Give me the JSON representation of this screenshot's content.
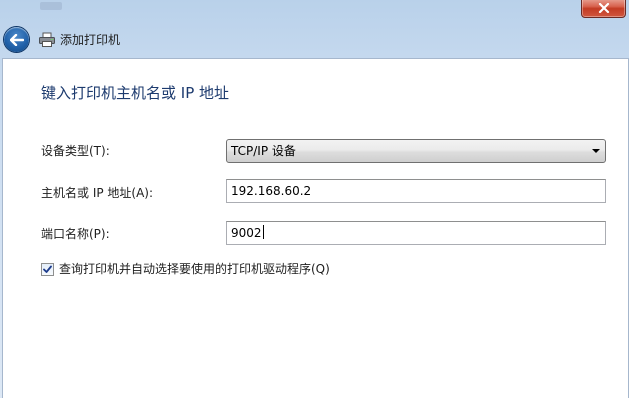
{
  "window": {
    "close_button_icon": "close-icon"
  },
  "navbar": {
    "back_icon": "back-arrow-icon",
    "printer_icon": "printer-icon",
    "title": "添加打印机"
  },
  "main": {
    "heading": "键入打印机主机名或 IP 地址",
    "device_type": {
      "label": "设备类型(T):",
      "value": "TCP/IP 设备",
      "options_visible": [
        "TCP/IP 设备"
      ]
    },
    "hostname": {
      "label": "主机名或 IP 地址(A):",
      "value": "192.168.60.2"
    },
    "port_name": {
      "label": "端口名称(P):",
      "value": "9002"
    },
    "query_driver": {
      "label": "查询打印机并自动选择要使用的打印机驱动程序(Q)",
      "checked": true
    }
  },
  "colors": {
    "heading": "#1c3a6e",
    "frame": "#c7daef",
    "close_button": "#c23b24",
    "back_button": "#1f5fa7"
  }
}
